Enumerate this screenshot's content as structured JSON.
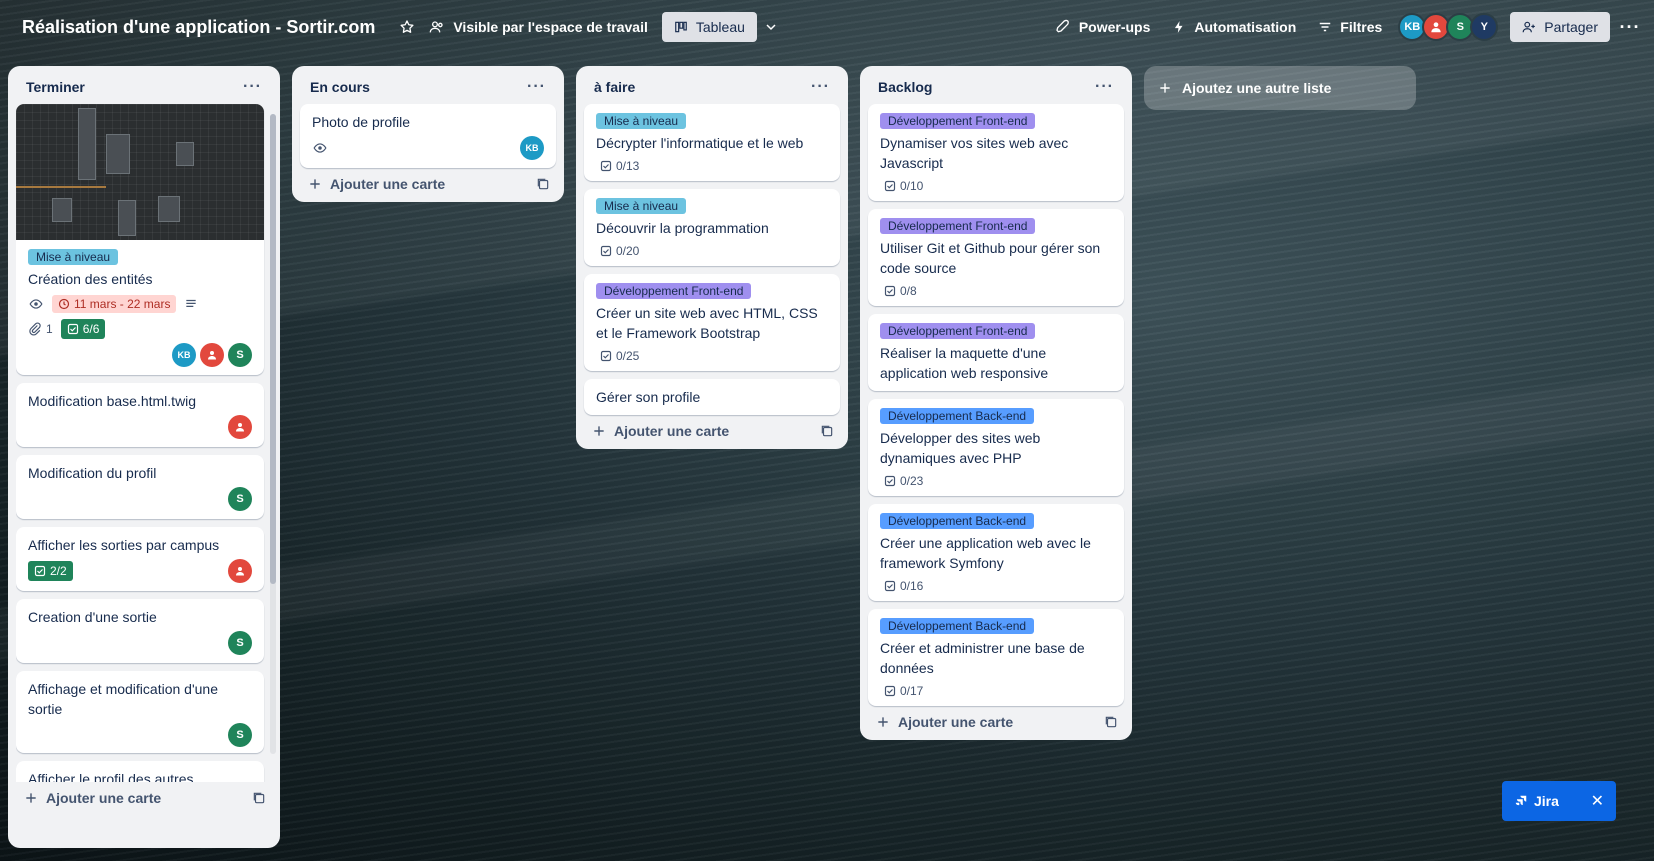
{
  "header": {
    "board_title": "Réalisation d'une application - Sortir.com",
    "visibility": "Visible par l'espace de travail",
    "view_tab": "Tableau",
    "powerups": "Power-ups",
    "automation": "Automatisation",
    "filters": "Filtres",
    "share": "Partager",
    "members": [
      {
        "initials": "KB",
        "color": "#1d9ac5"
      },
      {
        "initials": "",
        "color": "#e2483d"
      },
      {
        "initials": "S",
        "color": "#1f845a"
      },
      {
        "initials": "Y",
        "color": "#1f3a63"
      }
    ]
  },
  "lists": [
    {
      "title": "Terminer",
      "add_card": "Ajouter une carte",
      "cards": [
        {
          "label": "Mise à niveau",
          "title": "Création des entités",
          "date": "11 mars - 22 mars",
          "attachments": "1",
          "checklist": "6/6"
        },
        {
          "title": "Modification base.html.twig"
        },
        {
          "title": "Modification du profil"
        },
        {
          "title": "Afficher les sorties par campus",
          "checklist": "2/2"
        },
        {
          "title": "Creation d'une sortie"
        },
        {
          "title": "Affichage et modification d'une sortie"
        },
        {
          "title": "Afficher le profil des autres"
        }
      ]
    },
    {
      "title": "En cours",
      "add_card": "Ajouter une carte",
      "cards": [
        {
          "title": "Photo de profile"
        }
      ]
    },
    {
      "title": "à faire",
      "add_card": "Ajouter une carte",
      "cards": [
        {
          "label": "Mise à niveau",
          "title": "Décrypter l'informatique et le web",
          "checklist": "0/13"
        },
        {
          "label": "Mise à niveau",
          "title": "Découvrir la programmation",
          "checklist": "0/20"
        },
        {
          "label": "Développement Front-end",
          "title": "Créer un site web avec HTML, CSS et le Framework Bootstrap",
          "checklist": "0/25"
        },
        {
          "title": "Gérer son profile"
        }
      ]
    },
    {
      "title": "Backlog",
      "add_card": "Ajouter une carte",
      "cards": [
        {
          "label": "Développement Front-end",
          "title": "Dynamiser vos sites web avec Javascript",
          "checklist": "0/10"
        },
        {
          "label": "Développement Front-end",
          "title": "Utiliser Git et Github pour gérer son code source",
          "checklist": "0/8"
        },
        {
          "label": "Développement Front-end",
          "title": "Réaliser la maquette d'une application web responsive"
        },
        {
          "label": "Développement Back-end",
          "title": "Développer des sites web dynamiques avec PHP",
          "checklist": "0/23"
        },
        {
          "label": "Développement Back-end",
          "title": "Créer une application web avec le framework Symfony",
          "checklist": "0/16"
        },
        {
          "label": "Développement Back-end",
          "title": "Créer et administrer une base de données",
          "checklist": "0/17"
        }
      ]
    }
  ],
  "add_list": "Ajoutez une autre liste",
  "jira": {
    "label": "Jira"
  },
  "colors": {
    "label_cyan": "#6cc3e0",
    "label_purple": "#9f8fef",
    "label_blue": "#579dff",
    "done_green": "#1f845a",
    "date_red": "#ffd5d2"
  }
}
